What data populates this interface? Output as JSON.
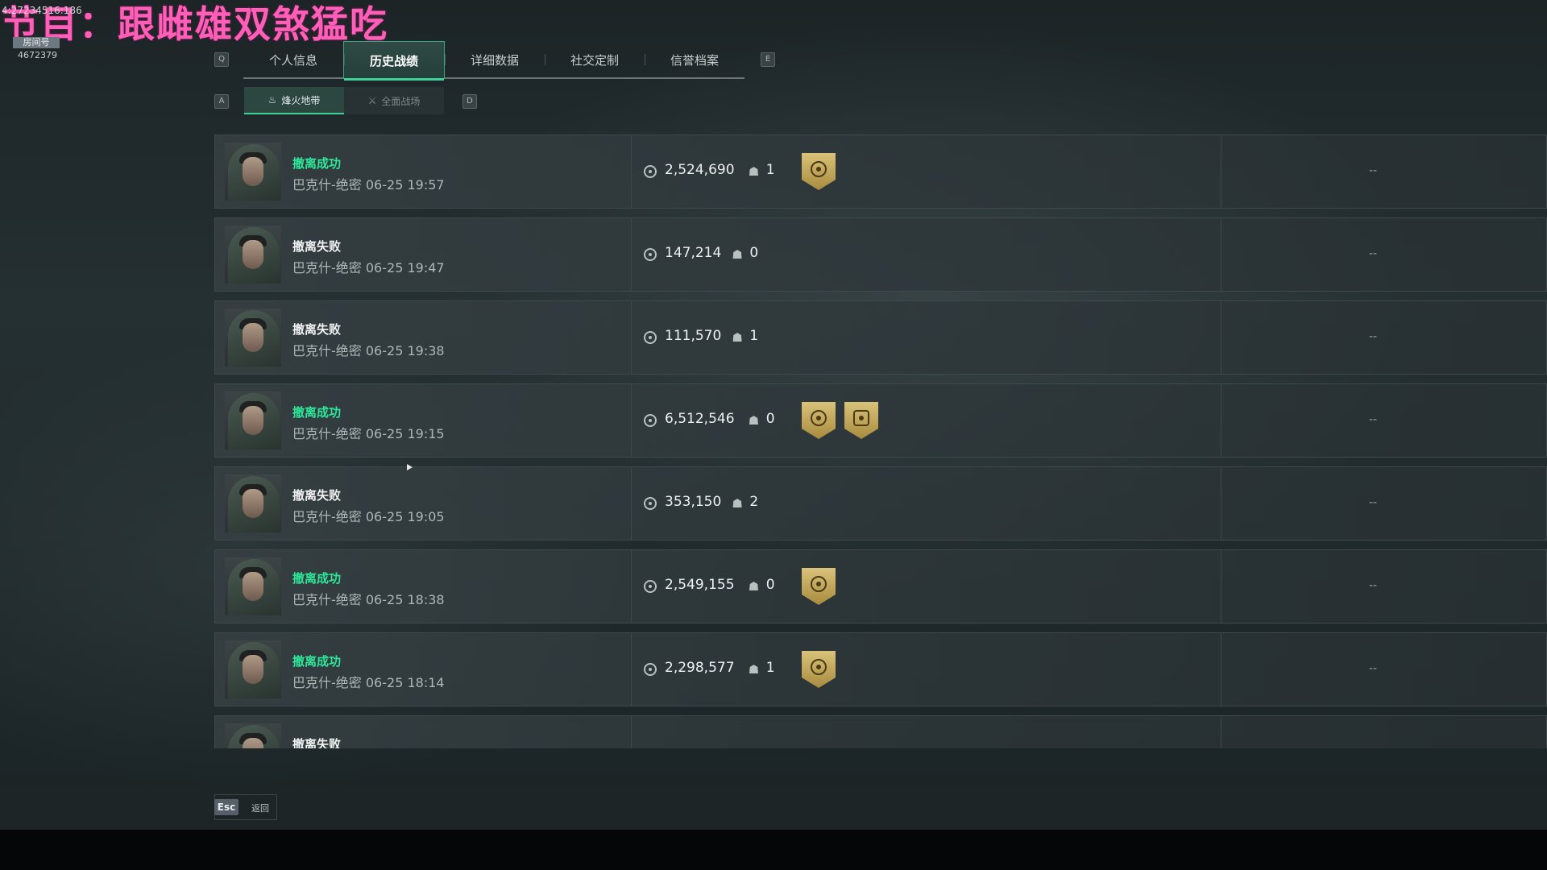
{
  "overlay": {
    "title": "节目：跟雌雄双煞猛吃",
    "code": "4:27234516:186",
    "badge": "房间号",
    "room_id": "4672379"
  },
  "keys": {
    "tab_prev": "Q",
    "tab_next": "E",
    "sub_prev": "A",
    "sub_next": "D"
  },
  "tabs": [
    {
      "label": "个人信息"
    },
    {
      "label": "历史战绩"
    },
    {
      "label": "详细数据"
    },
    {
      "label": "社交定制"
    },
    {
      "label": "信誉档案"
    }
  ],
  "active_tab": 1,
  "subtabs": [
    {
      "label": "烽火地带",
      "icon": "♨"
    },
    {
      "label": "全面战场",
      "icon": "⚔"
    }
  ],
  "records": [
    {
      "status": "撤离成功",
      "success": true,
      "map": "巴克什-绝密",
      "time": "06-25 19:57",
      "value": "2,524,690",
      "kills": "1",
      "medals": [
        "extract-medal-icon"
      ],
      "extra": "--"
    },
    {
      "status": "撤离失败",
      "success": false,
      "map": "巴克什-绝密",
      "time": "06-25 19:47",
      "value": "147,214",
      "kills": "0",
      "medals": [],
      "extra": "--"
    },
    {
      "status": "撤离失败",
      "success": false,
      "map": "巴克什-绝密",
      "time": "06-25 19:38",
      "value": "111,570",
      "kills": "1",
      "medals": [],
      "extra": "--"
    },
    {
      "status": "撤离成功",
      "success": true,
      "map": "巴克什-绝密",
      "time": "06-25 19:15",
      "value": "6,512,546",
      "kills": "0",
      "medals": [
        "extract-medal-icon",
        "wealth-medal-icon"
      ],
      "extra": "--"
    },
    {
      "status": "撤离失败",
      "success": false,
      "map": "巴克什-绝密",
      "time": "06-25 19:05",
      "value": "353,150",
      "kills": "2",
      "medals": [],
      "extra": "--"
    },
    {
      "status": "撤离成功",
      "success": true,
      "map": "巴克什-绝密",
      "time": "06-25 18:38",
      "value": "2,549,155",
      "kills": "0",
      "medals": [
        "extract-medal-icon"
      ],
      "extra": "--"
    },
    {
      "status": "撤离成功",
      "success": true,
      "map": "巴克什-绝密",
      "time": "06-25 18:14",
      "value": "2,298,577",
      "kills": "1",
      "medals": [
        "extract-medal-icon"
      ],
      "extra": "--"
    },
    {
      "status": "撤离失败",
      "success": false,
      "map": "",
      "time": "",
      "value": "",
      "kills": "",
      "medals": [],
      "extra": ""
    }
  ],
  "footer": {
    "esc_key": "Esc",
    "back_label": "返回"
  },
  "colors": {
    "accent": "#3fd198",
    "success_text": "#2ee89a",
    "overlay_title": "#ff5fb8"
  }
}
